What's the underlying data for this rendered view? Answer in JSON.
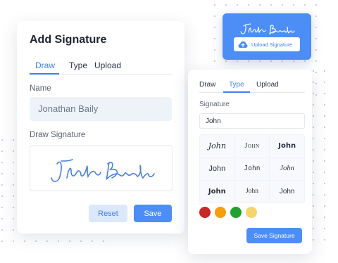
{
  "add_signature": {
    "title": "Add Signature",
    "tabs": [
      {
        "label": "Draw",
        "active": true
      },
      {
        "label": "Type",
        "active": false
      },
      {
        "label": "Upload",
        "active": false
      }
    ],
    "name_label": "Name",
    "name_value": "Jonathan Baily",
    "draw_label": "Draw Signature",
    "reset_label": "Reset",
    "save_label": "Save"
  },
  "upload_card": {
    "upload_label": "Upload Signature",
    "icon": "cloud-upload-icon"
  },
  "type_signature": {
    "tabs": [
      {
        "label": "Draw",
        "active": false
      },
      {
        "label": "Type",
        "active": true
      },
      {
        "label": "Upload",
        "active": false
      }
    ],
    "signature_label": "Signature",
    "signature_value": "John",
    "font_samples": [
      "John",
      "John",
      "John",
      "John",
      "John",
      "John",
      "John",
      "John",
      "John"
    ],
    "colors": [
      "#c62828",
      "#f59e0b",
      "#22a02e",
      "#f5d46a"
    ],
    "save_signature_label": "Save Signature"
  },
  "colors": {
    "accent": "#4c8ef5",
    "accent_light": "#dbe7fb"
  }
}
